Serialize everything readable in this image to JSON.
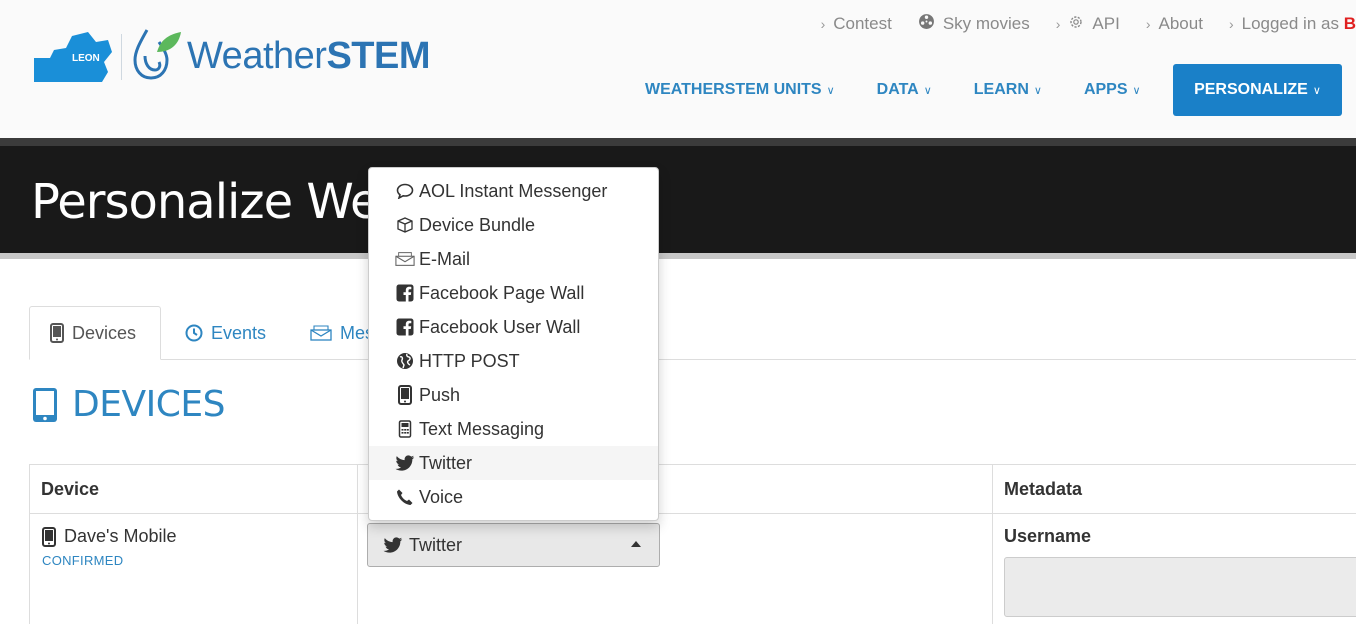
{
  "brand": {
    "logo_text": "LEON",
    "name_light": "Weather",
    "name_bold": "STEM"
  },
  "topnav": {
    "items": [
      {
        "label": "Contest",
        "icon": "chevron-right-icon"
      },
      {
        "label": "Sky movies",
        "icon": "film-reel-icon"
      },
      {
        "label": "API",
        "icon": "gear-icon"
      },
      {
        "label": "About",
        "icon": "chevron-right-icon"
      },
      {
        "label": "Logged in as",
        "icon": "chevron-right-icon"
      }
    ],
    "user_initial": "B"
  },
  "mainnav": {
    "items": [
      "WEATHERSTEM UNITS",
      "DATA",
      "LEARN",
      "APPS"
    ],
    "active": "PERSONALIZE"
  },
  "banner": {
    "title": "Personalize Weather"
  },
  "tabs": [
    {
      "label": "Devices",
      "icon": "mobile-icon"
    },
    {
      "label": "Events",
      "icon": "clock-icon"
    },
    {
      "label": "Messages",
      "icon": "envelope-icon"
    }
  ],
  "section": {
    "title": "DEVICES",
    "icon": "tablet-icon"
  },
  "table": {
    "headers": {
      "device": "Device",
      "metadata": "Metadata"
    },
    "rows": [
      {
        "device": "Dave's Mobile",
        "status": "CONFIRMED",
        "method": "Twitter",
        "meta_label": "Username",
        "meta_value": ""
      }
    ]
  },
  "dropdown": {
    "selected": "Twitter",
    "options": [
      {
        "label": "AOL Instant Messenger",
        "icon": "speech-bubble-icon"
      },
      {
        "label": "Device Bundle",
        "icon": "box-icon"
      },
      {
        "label": "E-Mail",
        "icon": "envelope-icon"
      },
      {
        "label": "Facebook Page Wall",
        "icon": "facebook-icon"
      },
      {
        "label": "Facebook User Wall",
        "icon": "facebook-icon"
      },
      {
        "label": "HTTP POST",
        "icon": "globe-icon"
      },
      {
        "label": "Push",
        "icon": "mobile-icon"
      },
      {
        "label": "Text Messaging",
        "icon": "cellphone-icon"
      },
      {
        "label": "Twitter",
        "icon": "twitter-icon"
      },
      {
        "label": "Voice",
        "icon": "phone-icon"
      }
    ]
  },
  "colors": {
    "accent": "#2e86c1",
    "active_nav": "#1a80c8",
    "banner": "#191919"
  }
}
